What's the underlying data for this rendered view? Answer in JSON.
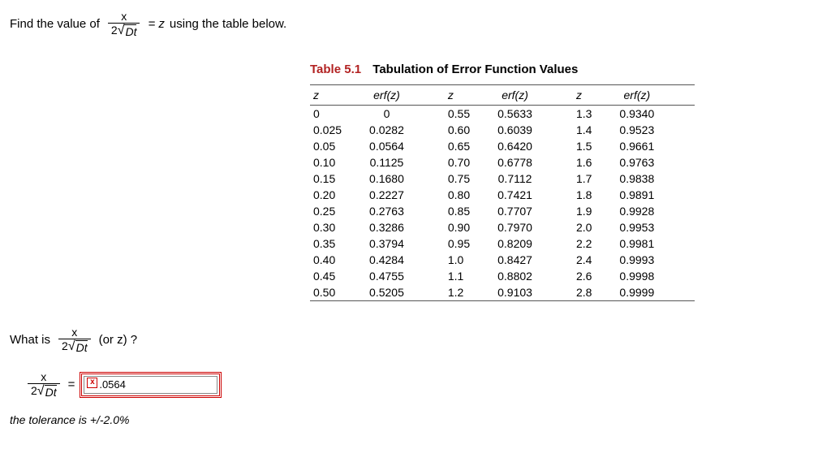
{
  "prompt_prefix": "Find the value of",
  "frac_num": "x",
  "frac_den_prefix": "2",
  "frac_den_sqrt": "Dt",
  "equals_z": "= z",
  "prompt_suffix": "using the table below.",
  "table_number": "Table 5.1",
  "table_title": "Tabulation of Error Function Values",
  "headers": [
    "z",
    "erf(z)",
    "z",
    "erf(z)",
    "z",
    "erf(z)"
  ],
  "chart_data": {
    "type": "table",
    "rows": [
      [
        "0",
        "0",
        "0.55",
        "0.5633",
        "1.3",
        "0.9340"
      ],
      [
        "0.025",
        "0.0282",
        "0.60",
        "0.6039",
        "1.4",
        "0.9523"
      ],
      [
        "0.05",
        "0.0564",
        "0.65",
        "0.6420",
        "1.5",
        "0.9661"
      ],
      [
        "0.10",
        "0.1125",
        "0.70",
        "0.6778",
        "1.6",
        "0.9763"
      ],
      [
        "0.15",
        "0.1680",
        "0.75",
        "0.7112",
        "1.7",
        "0.9838"
      ],
      [
        "0.20",
        "0.2227",
        "0.80",
        "0.7421",
        "1.8",
        "0.9891"
      ],
      [
        "0.25",
        "0.2763",
        "0.85",
        "0.7707",
        "1.9",
        "0.9928"
      ],
      [
        "0.30",
        "0.3286",
        "0.90",
        "0.7970",
        "2.0",
        "0.9953"
      ],
      [
        "0.35",
        "0.3794",
        "0.95",
        "0.8209",
        "2.2",
        "0.9981"
      ],
      [
        "0.40",
        "0.4284",
        "1.0",
        "0.8427",
        "2.4",
        "0.9993"
      ],
      [
        "0.45",
        "0.4755",
        "1.1",
        "0.8802",
        "2.6",
        "0.9998"
      ],
      [
        "0.50",
        "0.5205",
        "1.2",
        "0.9103",
        "2.8",
        "0.9999"
      ]
    ]
  },
  "question_prefix": "What is",
  "question_suffix": "(or z) ?",
  "answer_equals": "=",
  "answer_value": ".0564",
  "x_mark": "x",
  "tolerance_text": "the tolerance is +/-2.0%"
}
